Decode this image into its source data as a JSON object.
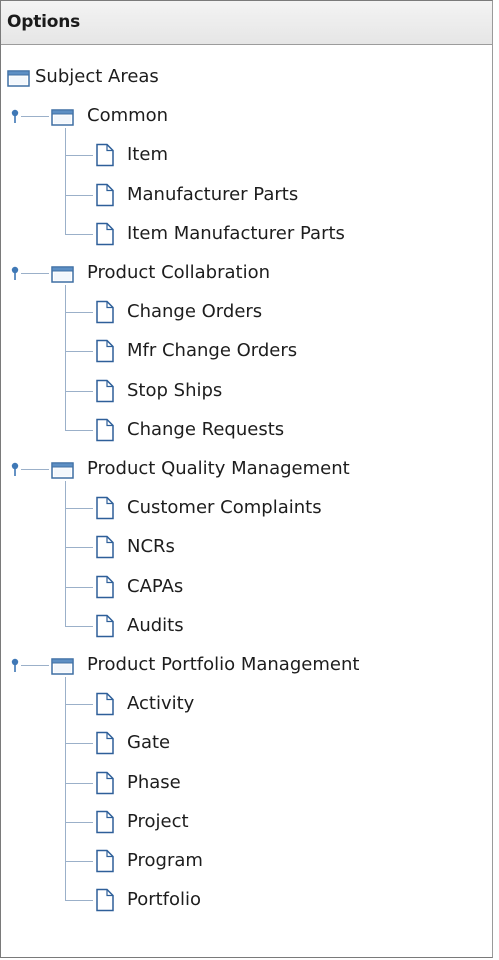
{
  "panel": {
    "title": "Options"
  },
  "tree": {
    "root": {
      "label": "Subject Areas",
      "icon": "folder-icon",
      "groups": [
        {
          "label": "Common",
          "icon": "folder-icon",
          "expanded": true,
          "items": [
            {
              "label": "Item",
              "icon": "document-icon"
            },
            {
              "label": "Manufacturer Parts",
              "icon": "document-icon"
            },
            {
              "label": "Item Manufacturer Parts",
              "icon": "document-icon"
            }
          ]
        },
        {
          "label": "Product Collabration",
          "icon": "folder-icon",
          "expanded": true,
          "items": [
            {
              "label": "Change Orders",
              "icon": "document-icon"
            },
            {
              "label": "Mfr Change Orders",
              "icon": "document-icon"
            },
            {
              "label": "Stop Ships",
              "icon": "document-icon"
            },
            {
              "label": "Change Requests",
              "icon": "document-icon"
            }
          ]
        },
        {
          "label": "Product Quality Management",
          "icon": "folder-icon",
          "expanded": true,
          "items": [
            {
              "label": "Customer Complaints",
              "icon": "document-icon"
            },
            {
              "label": "NCRs",
              "icon": "document-icon"
            },
            {
              "label": "CAPAs",
              "icon": "document-icon"
            },
            {
              "label": "Audits",
              "icon": "document-icon"
            }
          ]
        },
        {
          "label": "Product Portfolio Management",
          "icon": "folder-icon",
          "expanded": true,
          "items": [
            {
              "label": "Activity",
              "icon": "document-icon"
            },
            {
              "label": "Gate",
              "icon": "document-icon"
            },
            {
              "label": "Phase",
              "icon": "document-icon"
            },
            {
              "label": "Project",
              "icon": "document-icon"
            },
            {
              "label": "Program",
              "icon": "document-icon"
            },
            {
              "label": "Portfolio",
              "icon": "document-icon"
            }
          ]
        }
      ]
    }
  },
  "colors": {
    "connector": "#9bb0c9",
    "folder_tab": "#5d8fc4",
    "folder_border": "#3f6fa3",
    "document_border": "#2e5f99",
    "handle": "#3f78b6"
  }
}
